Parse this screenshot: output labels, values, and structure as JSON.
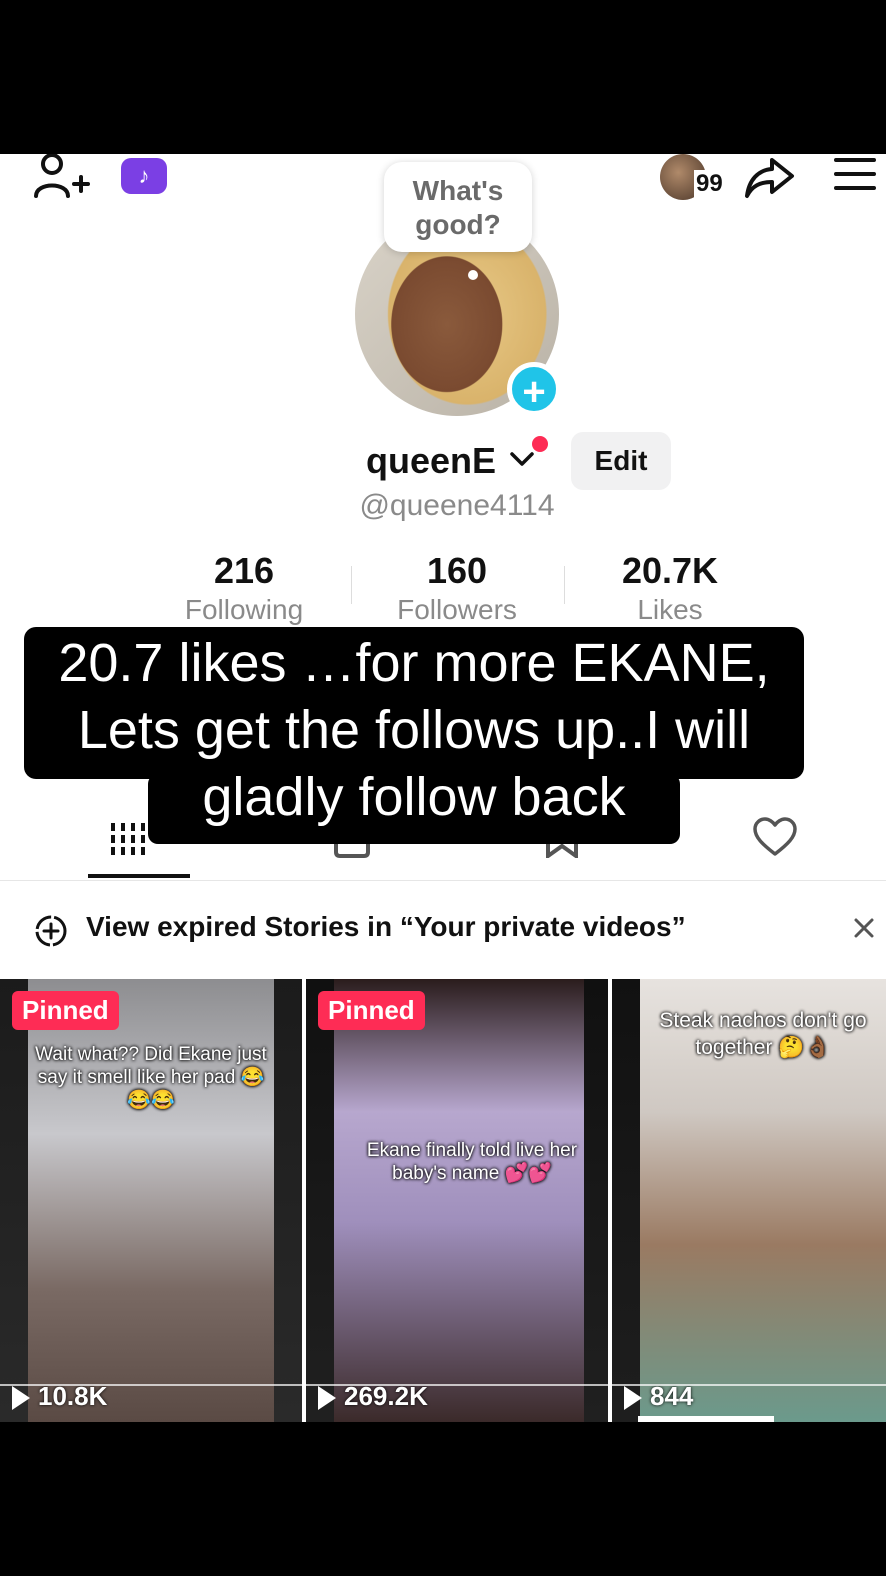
{
  "header": {
    "visitor_count": "99"
  },
  "profile": {
    "bubble_text": "What's good?",
    "username": "queenE",
    "edit_label": "Edit",
    "handle": "@queene4114"
  },
  "stats": [
    {
      "num": "216",
      "label": "Following"
    },
    {
      "num": "160",
      "label": "Followers"
    },
    {
      "num": "20.7K",
      "label": "Likes"
    }
  ],
  "caption": {
    "line1": "20.7 likes …for more EKANE,",
    "line2": "Lets get the follows up..I will",
    "line3": "gladly follow back"
  },
  "notice": {
    "text": "View expired Stories in “Your private videos”"
  },
  "videos": [
    {
      "pinned": "Pinned",
      "overlay": "Wait what?? Did Ekane just say it smell like her pad 😂😂😂",
      "views": "10.8K"
    },
    {
      "pinned": "Pinned",
      "overlay": "Ekane finally told live her baby's name 💕💕",
      "views": "269.2K"
    },
    {
      "pinned": "",
      "overlay": "Steak nachos don't go together 🤔👌🏾",
      "views": "844"
    }
  ],
  "colors": {
    "accent_red": "#fe2c55",
    "plus_blue": "#20c4e8",
    "badge_purple": "#7b3fe4"
  }
}
